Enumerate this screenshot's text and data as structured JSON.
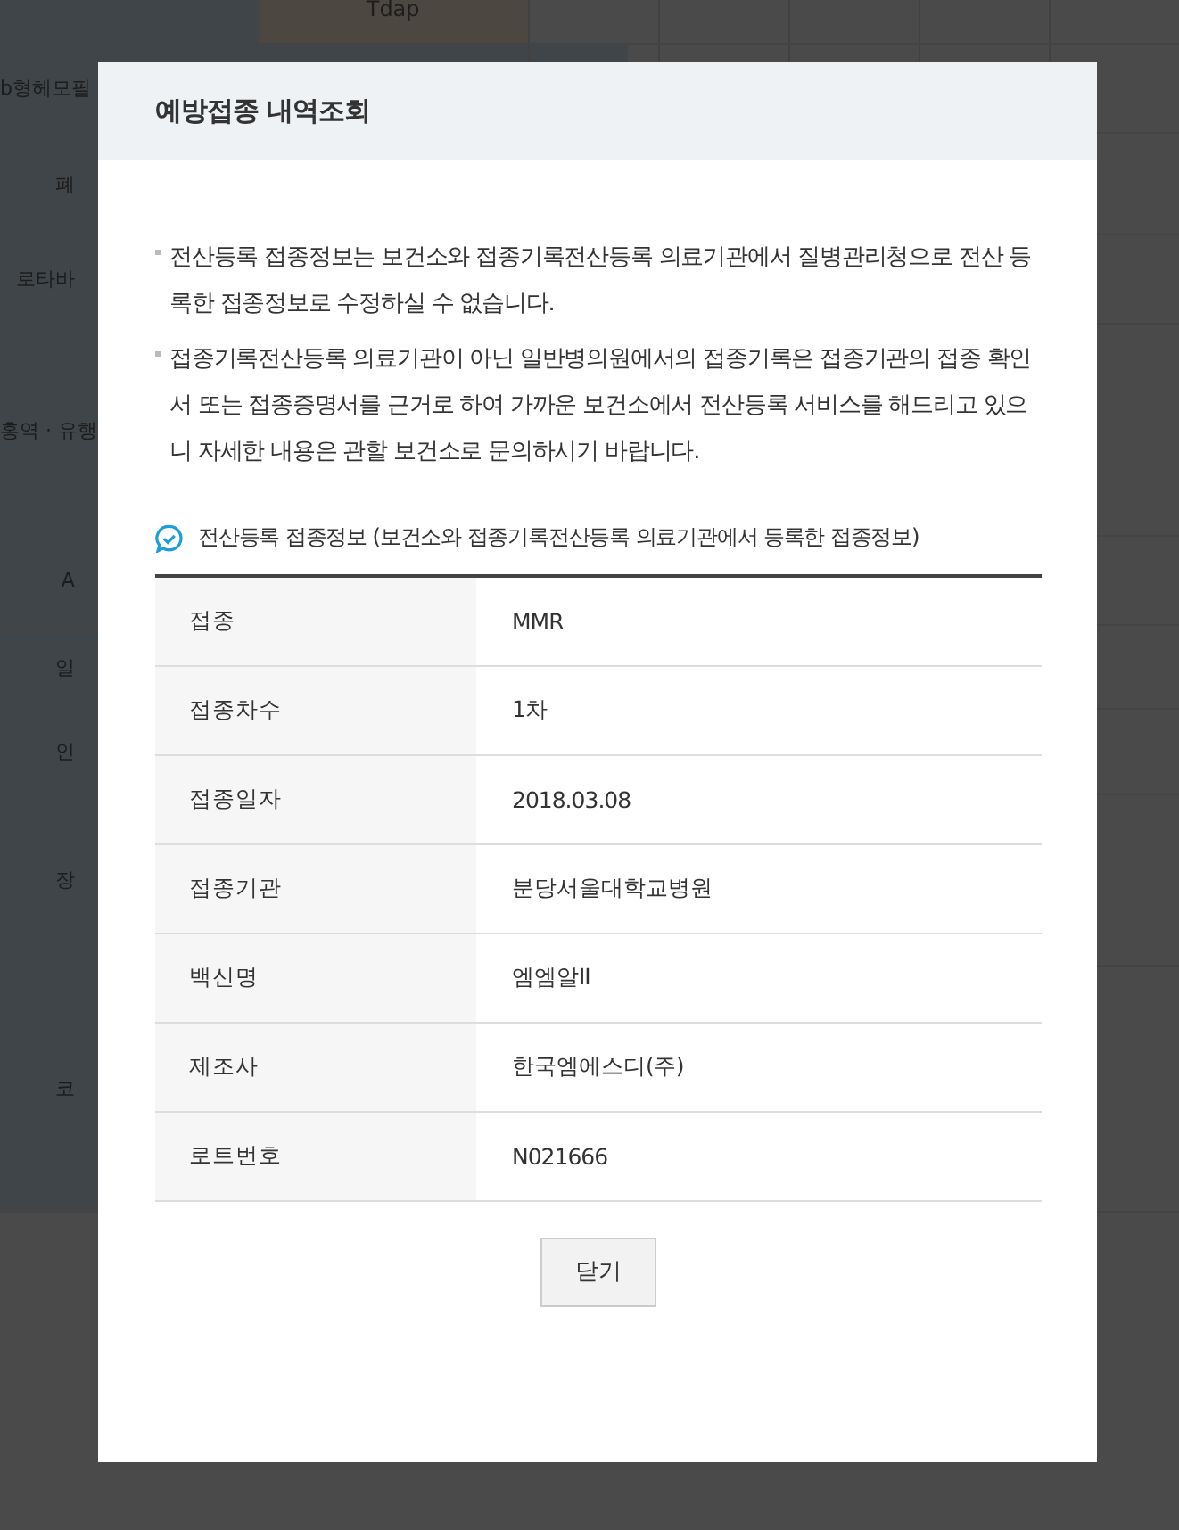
{
  "background": {
    "header": "Tdap",
    "row_labels": [
      "b형헤모필",
      "폐",
      "로타바",
      "홍역 · 유행",
      "A",
      "일",
      "인",
      "장",
      "코"
    ]
  },
  "dialog": {
    "title": "예방접종 내역조회",
    "notes": [
      "전산등록 접종정보는 보건소와 접종기록전산등록 의료기관에서 질병관리청으로 전산 등록한 접종정보로 수정하실 수 없습니다.",
      "접종기록전산등록 의료기관이 아닌 일반병의원에서의 접종기록은 접종기관의 접종 확인서 또는 접종증명서를 근거로 하여 가까운 보건소에서 전산등록 서비스를 해드리고 있으니 자세한 내용은 관할 보건소로 문의하시기 바랍니다."
    ],
    "section_title": "전산등록 접종정보 (보건소와 접종기록전산등록 의료기관에서 등록한 접종정보)",
    "rows": [
      {
        "label": "접종",
        "value": "MMR"
      },
      {
        "label": "접종차수",
        "value": "1차"
      },
      {
        "label": "접종일자",
        "value": "2018.03.08"
      },
      {
        "label": "접종기관",
        "value": "분당서울대학교병원"
      },
      {
        "label": "백신명",
        "value": "엠엠알II"
      },
      {
        "label": "제조사",
        "value": "한국엠에스디(주)"
      },
      {
        "label": "로트번호",
        "value": "N021666"
      }
    ],
    "close_button": "닫기"
  }
}
